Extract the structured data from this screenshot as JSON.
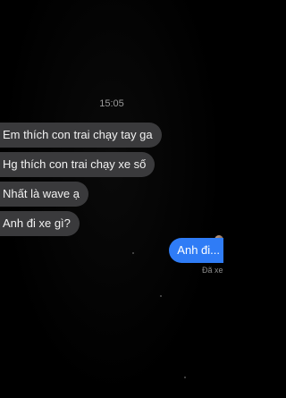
{
  "chat": {
    "time": "15:05",
    "incoming": [
      {
        "text": "Em thích con trai chạy tay ga"
      },
      {
        "text": "Hg thích con trai chạy xe số"
      },
      {
        "text": "Nhất là wave ạ"
      },
      {
        "text": "Anh đi xe gì?"
      }
    ],
    "outgoing": {
      "text": "Anh đi...",
      "status": "Đã xem"
    }
  },
  "colors": {
    "background": "#000000",
    "incoming_bubble": "#3a3a3c",
    "outgoing_bubble": "#2f7cf6",
    "timestamp_text": "#9a9a9a"
  }
}
